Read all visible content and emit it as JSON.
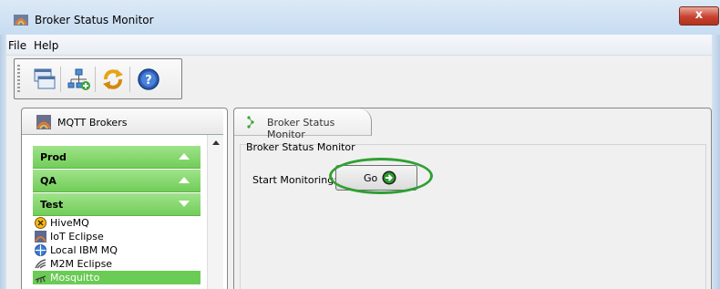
{
  "window": {
    "title": "Broker Status Monitor",
    "close_label": "x"
  },
  "menu": {
    "items": [
      "File",
      "Help"
    ]
  },
  "toolbar": {
    "buttons": [
      "windows-icon",
      "network-icon",
      "refresh-icon",
      "help-icon"
    ]
  },
  "left_panel": {
    "tab_label": "MQTT Brokers",
    "groups": [
      {
        "label": "Prod",
        "expanded": false
      },
      {
        "label": "QA",
        "expanded": false
      },
      {
        "label": "Test",
        "expanded": true
      }
    ],
    "test_items": [
      {
        "label": "HiveMQ",
        "icon": "hivemq-icon"
      },
      {
        "label": "IoT Eclipse",
        "icon": "iot-eclipse-icon"
      },
      {
        "label": "Local IBM MQ",
        "icon": "ibm-mq-icon"
      },
      {
        "label": "M2M Eclipse",
        "icon": "m2m-icon"
      },
      {
        "label": "Mosquitto",
        "icon": "mosquitto-icon",
        "selected": true
      }
    ]
  },
  "right_panel": {
    "tab_label": "Broker Status Monitor",
    "section_title": "Broker Status Monitor",
    "start_label": "Start Monitoring:",
    "go_label": "Go"
  },
  "colors": {
    "accordion_green": "#72cd59",
    "highlight_ellipse": "#2fa033",
    "selection": "#6acb55"
  }
}
